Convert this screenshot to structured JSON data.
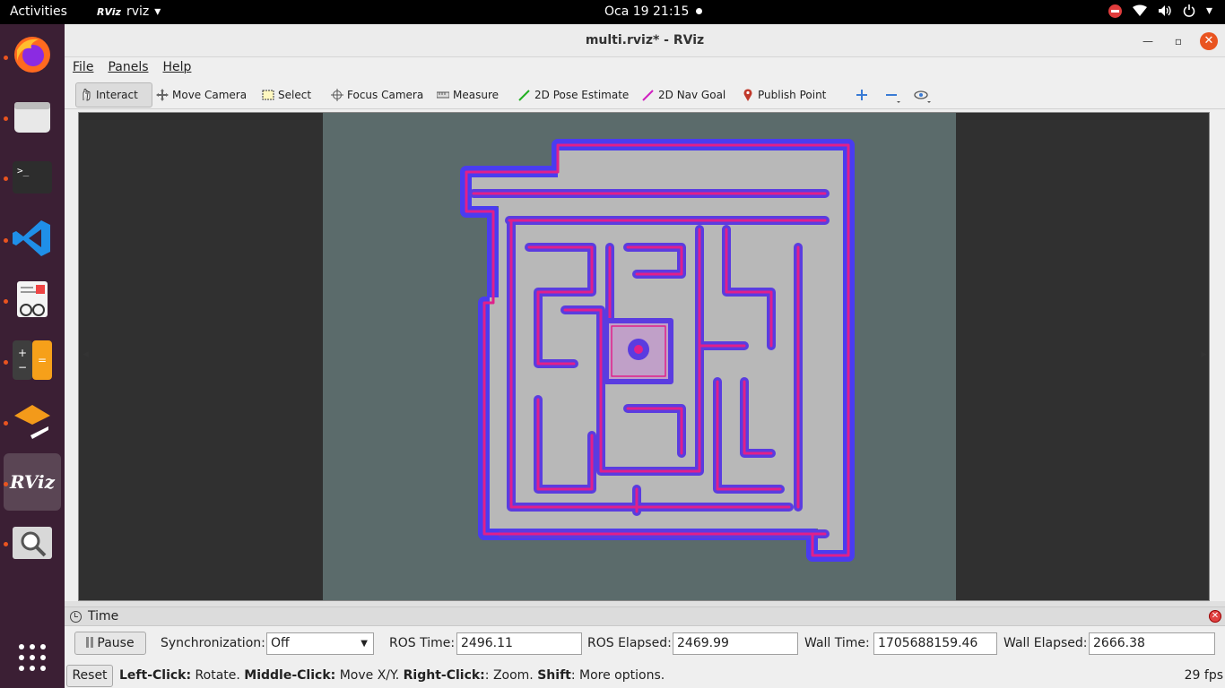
{
  "topbar": {
    "activities": "Activities",
    "app_name": "rviz",
    "app_logo_text": "RViz",
    "clock": "Oca 19  21:15"
  },
  "dock": {
    "items": [
      "firefox",
      "files",
      "terminal",
      "vscode",
      "document-viewer",
      "calculator",
      "ros-app",
      "rviz",
      "image-viewer"
    ],
    "rviz_label": "RViz"
  },
  "window": {
    "title": "multi.rviz* - RViz",
    "menu": {
      "file": "File",
      "panels": "Panels",
      "help": "Help"
    },
    "toolbar": {
      "interact": "Interact",
      "move_camera": "Move Camera",
      "select": "Select",
      "focus_camera": "Focus Camera",
      "measure": "Measure",
      "pose_estimate": "2D Pose Estimate",
      "nav_goal": "2D Nav Goal",
      "publish_point": "Publish Point"
    },
    "colors": {
      "map_background": "#5b6b6b",
      "costmap_inflation": "#4a3cf0",
      "costmap_lethal": "#e0208a",
      "free_space": "#b8b8b8"
    }
  },
  "time_panel": {
    "title": "Time",
    "pause": "Pause",
    "sync_label": "Synchronization:",
    "sync_value": "Off",
    "ros_time_label": "ROS Time:",
    "ros_time": "2496.11",
    "ros_elapsed_label": "ROS Elapsed:",
    "ros_elapsed": "2469.99",
    "wall_time_label": "Wall Time:",
    "wall_time": "1705688159.46",
    "wall_elapsed_label": "Wall Elapsed:",
    "wall_elapsed": "2666.38"
  },
  "status": {
    "reset": "Reset",
    "left_click": "Left-Click:",
    "left_click_desc": " Rotate. ",
    "middle_click": "Middle-Click:",
    "middle_click_desc": " Move X/Y. ",
    "right_click": "Right-Click:",
    "right_click_desc": ": Zoom. ",
    "shift": "Shift",
    "shift_desc": ": More options.",
    "fps": "29 fps"
  }
}
